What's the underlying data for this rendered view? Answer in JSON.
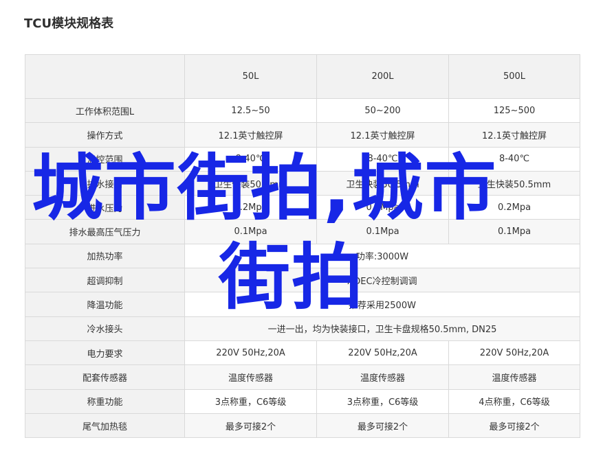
{
  "page": {
    "title": "TCU模块规格表"
  },
  "table": {
    "header": [
      "",
      "50L",
      "200L",
      "500L"
    ],
    "rows": [
      {
        "label": "工作体积范围L",
        "cells": [
          "12.5~50",
          "50~200",
          "125~500"
        ]
      },
      {
        "label": "操作方式",
        "cells": [
          "12.1英寸触控屏",
          "12.1英寸触控屏",
          "12.1英寸触控屏"
        ]
      },
      {
        "label": "温控范围",
        "cells": [
          "8-40℃",
          "8-40℃",
          "8-40℃"
        ]
      },
      {
        "label": "排水接口",
        "cells": [
          "卫生快装50.5mm",
          "卫生快装50.5mm",
          "卫生快装50.5mm"
        ]
      },
      {
        "label": "进水压力",
        "cells": [
          "0.2Mpa",
          "0.2Mpa",
          "0.2Mpa"
        ]
      },
      {
        "label": "排水最高压气压力",
        "cells": [
          "0.1Mpa",
          "0.1Mpa",
          "0.1Mpa"
        ]
      },
      {
        "label": "加热功率",
        "span": "功率:3000W"
      },
      {
        "label": "超调抑制",
        "span": "ADEC冷控制调调"
      },
      {
        "label": "降温功能",
        "span": "推荐采用2500W"
      },
      {
        "label": "冷水接头",
        "span": "一进一出，均为快装接口，卫生卡盘规格50.5mm, DN25"
      },
      {
        "label": "电力要求",
        "cells": [
          "220V 50Hz,20A",
          "220V 50Hz,20A",
          "220V 50Hz,20A"
        ]
      },
      {
        "label": "配套传感器",
        "cells": [
          "温度传感器",
          "温度传感器",
          "温度传感器"
        ]
      },
      {
        "label": "称重功能",
        "cells": [
          "3点称重，C6等级",
          "3点称重，C6等级",
          "4点称重，C6等级"
        ]
      },
      {
        "label": "尾气加热毯",
        "cells": [
          "最多可接2个",
          "最多可接2个",
          "最多可接2个"
        ]
      }
    ]
  },
  "watermark": {
    "line1": "城市街拍,城市",
    "line2": "街拍"
  }
}
